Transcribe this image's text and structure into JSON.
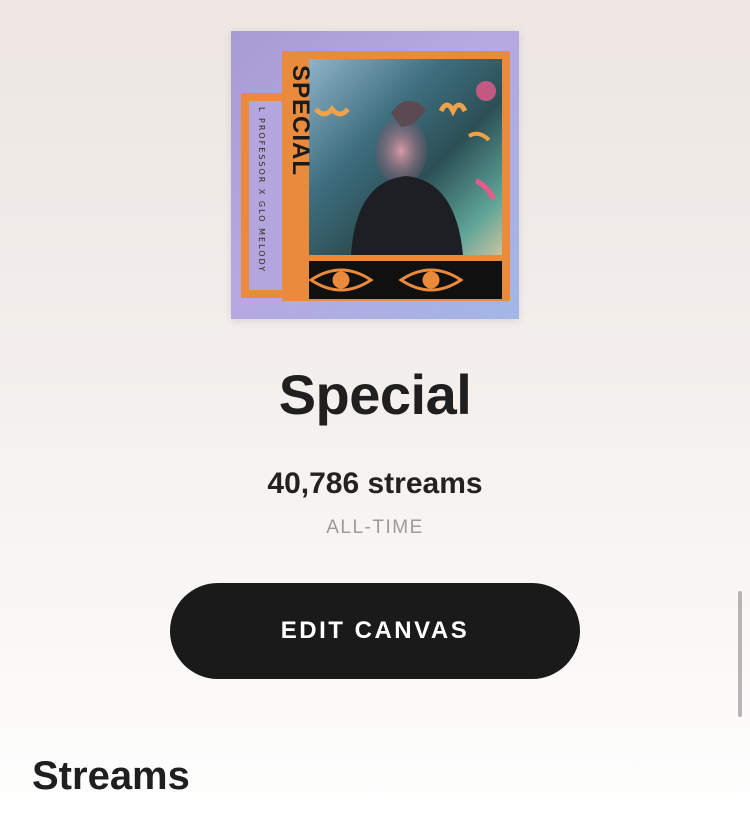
{
  "album_art": {
    "title_text": "SPECIAL",
    "artist_text": "L PROFESSOR X GLO MELODY",
    "colors": {
      "background": "#b0a4dc",
      "frame": "#e98a3c",
      "photo": "#4a7a8a"
    }
  },
  "track": {
    "title": "Special",
    "streams": "40,786 streams",
    "period": "ALL-TIME"
  },
  "actions": {
    "edit_canvas_label": "EDIT CANVAS"
  },
  "sections": {
    "streams_heading": "Streams"
  },
  "colors": {
    "button_bg": "#1b1a1a",
    "button_text": "#ffffff",
    "muted_text": "#9b9b9b"
  }
}
